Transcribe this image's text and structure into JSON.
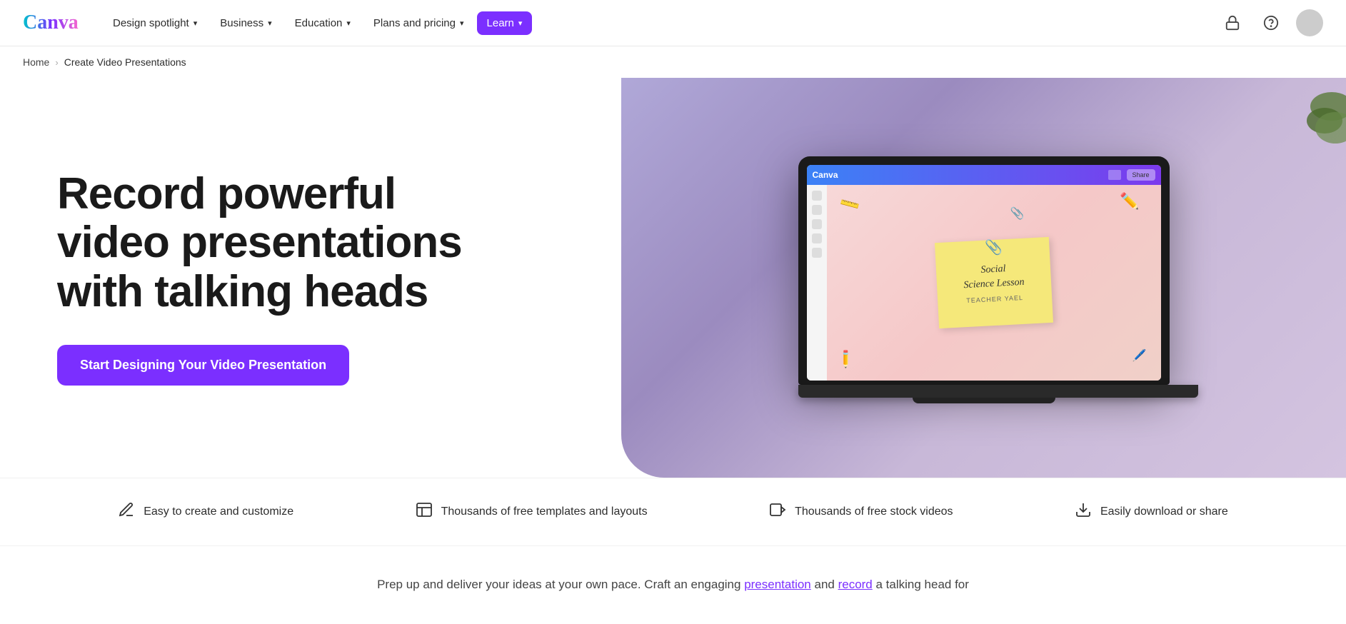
{
  "nav": {
    "logo_text": "Canva",
    "items": [
      {
        "id": "design-spotlight",
        "label": "Design spotlight",
        "has_chevron": true,
        "active": false
      },
      {
        "id": "business",
        "label": "Business",
        "has_chevron": true,
        "active": false
      },
      {
        "id": "education",
        "label": "Education",
        "has_chevron": true,
        "active": false
      },
      {
        "id": "plans-pricing",
        "label": "Plans and pricing",
        "has_chevron": true,
        "active": false
      },
      {
        "id": "learn",
        "label": "Learn",
        "has_chevron": true,
        "active": true
      }
    ],
    "lock_icon": "⊕",
    "help_icon": "?",
    "avatar_alt": "User avatar"
  },
  "breadcrumb": {
    "home": "Home",
    "separator": "›",
    "current": "Create Video Presentations"
  },
  "hero": {
    "heading_line1": "Record powerful",
    "heading_line2": "video presentations",
    "heading_line3": "with talking heads",
    "cta_label": "Start Designing Your Video Presentation"
  },
  "laptop": {
    "titlebar_text": "Canva",
    "note_line1": "Social",
    "note_line2": "Science Lesson",
    "note_teacher": "TEACHER YAEL"
  },
  "features": [
    {
      "id": "create",
      "icon": "✏️",
      "label": "Easy to create and customize"
    },
    {
      "id": "templates",
      "icon": "⊡",
      "label": "Thousands of free templates and layouts"
    },
    {
      "id": "videos",
      "icon": "▶",
      "label": "Thousands of free stock videos"
    },
    {
      "id": "download",
      "icon": "⬇",
      "label": "Easily download or share"
    }
  ],
  "bottom": {
    "text_before": "Prep up and deliver your ideas at your own pace. Craft an engaging ",
    "link1": "presentation",
    "text_middle": " and ",
    "link2": "record",
    "text_after": " a talking head for"
  }
}
